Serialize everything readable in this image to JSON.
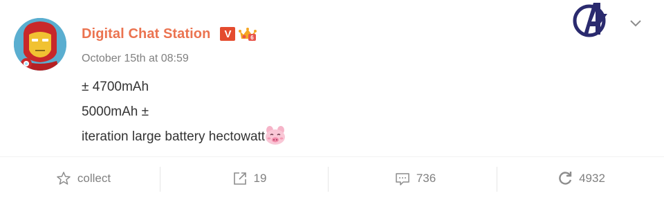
{
  "post": {
    "author": "Digital Chat Station",
    "verified_badge": "V",
    "member_badge_icon": "vip-crown-icon",
    "timestamp": "October 15th at 08:59",
    "lines": [
      "± 4700mAh",
      "5000mAh ±",
      "iteration large battery hectowatt"
    ],
    "inline_emoji": "pig-face-emoji"
  },
  "header": {
    "brand_icon": "avengers-logo-icon",
    "menu_icon": "chevron-down-icon"
  },
  "toolbar": {
    "collect_label": "collect",
    "repost_count": "19",
    "comment_count": "736",
    "like_count": "4932"
  },
  "colors": {
    "author_name": "#eb7350",
    "verified_badge": "#e44b2e",
    "muted_text": "#808080",
    "body_text": "#333333"
  }
}
